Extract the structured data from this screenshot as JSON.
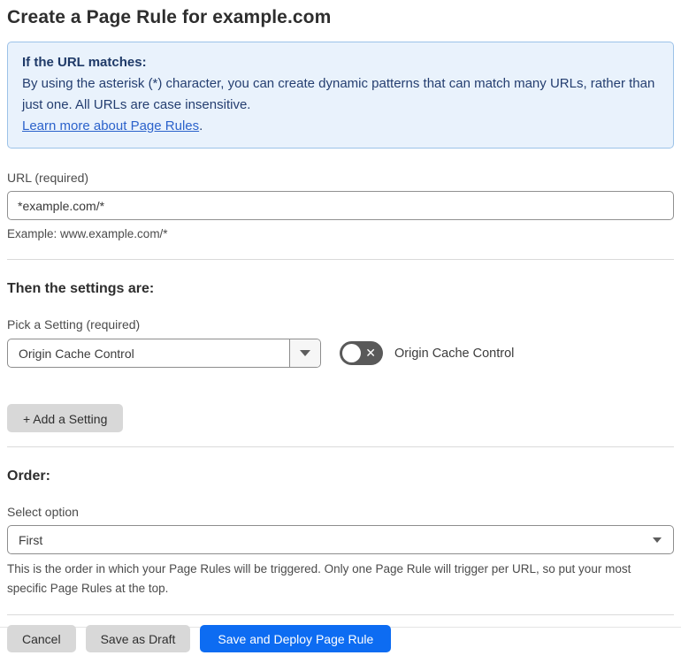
{
  "page": {
    "title": "Create a Page Rule for example.com"
  },
  "info_box": {
    "heading": "If the URL matches:",
    "body": "By using the asterisk (*) character, you can create dynamic patterns that can match many URLs, rather than just one. All URLs are case insensitive.",
    "link_label": "Learn more about Page Rules",
    "link_suffix": "."
  },
  "url_field": {
    "label": "URL (required)",
    "value": "*example.com/*",
    "example": "Example: www.example.com/*"
  },
  "settings_section": {
    "heading": "Then the settings are:",
    "picker_label": "Pick a Setting (required)",
    "picker_value": "Origin Cache Control",
    "toggle_label": "Origin Cache Control",
    "toggle_state": "off",
    "toggle_off_glyph": "✕",
    "add_setting_button": "+ Add a Setting"
  },
  "order_section": {
    "heading": "Order:",
    "label": "Select option",
    "value": "First",
    "help": "This is the order in which your Page Rules will be triggered. Only one Page Rule will trigger per URL, so put your most specific Page Rules at the top."
  },
  "footer": {
    "cancel_label": "Cancel",
    "save_draft_label": "Save as Draft",
    "save_deploy_label": "Save and Deploy Page Rule"
  },
  "colors": {
    "accent_blue": "#0d6cf2",
    "info_bg": "#e9f2fc",
    "info_border": "#9cc2e8",
    "info_text": "#243e70",
    "link_blue": "#2b62cb",
    "toggle_off_bg": "#595959",
    "gray_button_bg": "#d8d8d8",
    "divider": "#dadada"
  }
}
